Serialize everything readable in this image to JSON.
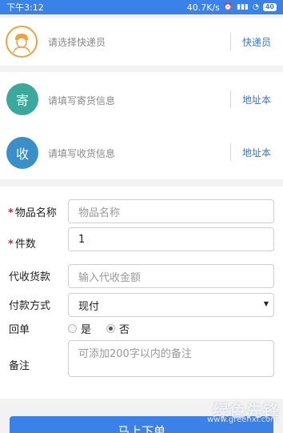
{
  "status_bar": {
    "time": "下午3:12",
    "net_speed": "40.7K/s",
    "battery": "40"
  },
  "courier": {
    "placeholder": "请选择快递员",
    "link": "快递员"
  },
  "sender": {
    "badge": "寄",
    "placeholder": "请填写寄货信息",
    "link": "地址本",
    "badge_color": "#3aa89a"
  },
  "receiver": {
    "badge": "收",
    "placeholder": "请填写收货信息",
    "link": "地址本",
    "badge_color": "#3a8fc8"
  },
  "form": {
    "item_name": {
      "label": "物品名称",
      "placeholder": "物品名称"
    },
    "quantity": {
      "label": "件数",
      "value": "1"
    },
    "cod": {
      "label": "代收货款",
      "placeholder": "输入代收金额"
    },
    "payment": {
      "label": "付款方式",
      "selected": "现付"
    },
    "receipt": {
      "label": "回单",
      "yes": "是",
      "no": "否"
    },
    "remark": {
      "label": "备注",
      "placeholder": "可添加200字以内的备注"
    },
    "required_mark": "*"
  },
  "submit": {
    "label": "马上下单"
  },
  "watermark": {
    "text": "绿色先锋",
    "url": "www.greenxf.com"
  },
  "colors": {
    "accent": "#3b82e8",
    "link": "#2f7ad8",
    "required": "#dd2222"
  }
}
